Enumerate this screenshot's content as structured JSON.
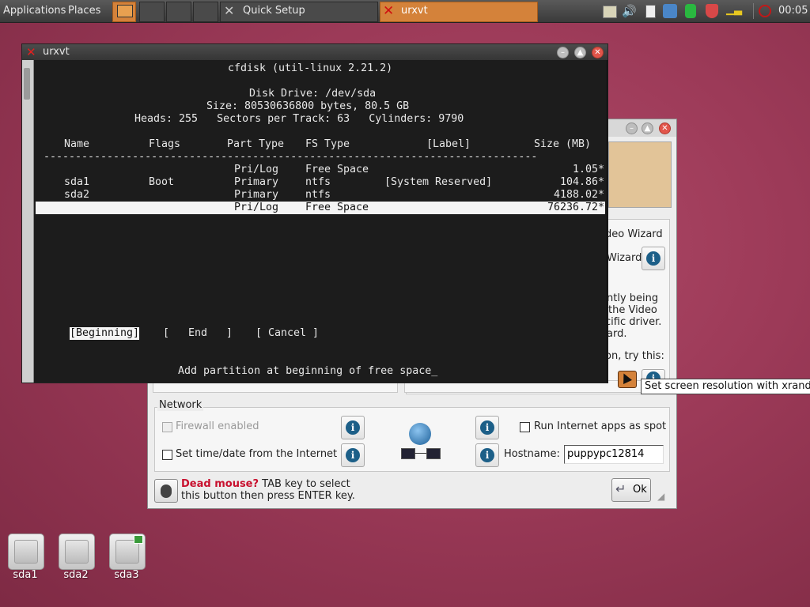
{
  "taskbar": {
    "applications_label": "Applications",
    "places_label": "Places",
    "task_quick_setup": "Quick Setup",
    "task_urxvt": "urxvt",
    "clock": "00:05"
  },
  "terminal": {
    "title": "urxvt",
    "program_title": "cfdisk (util-linux 2.21.2)",
    "disk_drive": "Disk Drive: /dev/sda",
    "size_line": "Size: 80530636800 bytes, 80.5 GB",
    "geometry_line": "Heads: 255   Sectors per Track: 63   Cylinders: 9790",
    "columns": [
      "Name",
      "Flags",
      "Part Type",
      "FS Type",
      "[Label]",
      "Size (MB)"
    ],
    "separator": "------------------------------------------------------------------------------",
    "rows": [
      {
        "name": "",
        "flags": "",
        "part_type": "Pri/Log",
        "fs_type": "Free Space",
        "label": "",
        "size": "1.05*"
      },
      {
        "name": "sda1",
        "flags": "Boot",
        "part_type": "Primary",
        "fs_type": "ntfs",
        "label": "[System Reserved]",
        "size": "104.86*"
      },
      {
        "name": "sda2",
        "flags": "",
        "part_type": "Primary",
        "fs_type": "ntfs",
        "label": "",
        "size": "4188.02*"
      },
      {
        "name": "",
        "flags": "",
        "part_type": "Pri/Log",
        "fs_type": "Free Space",
        "label": "",
        "size": "76236.72*"
      }
    ],
    "selected_row_index": 3,
    "menu": {
      "beginning": "[Beginning]",
      "end": "[   End   ]",
      "cancel": "[ Cancel ]"
    },
    "prompt": "Add partition at beginning of free space_"
  },
  "quick_setup": {
    "video_wizard_fragment": "deo Wizard",
    "wizard_fragment": "Wizard",
    "desc_lines": [
      "ntly being",
      "the Video",
      "cific driver.",
      "ard."
    ],
    "try_this": "on, try this:",
    "network_title": "Network",
    "firewall_label": "Firewall enabled",
    "set_time_label": "Set time/date from the Internet",
    "run_internet_label": "Run Internet apps as spot",
    "hostname_label": "Hostname:",
    "hostname_value": "puppypc12814",
    "dead_mouse_bold": "Dead mouse?",
    "dead_mouse_rest_1": " TAB key to select",
    "dead_mouse_tab": "TAB",
    "dead_mouse_line2": "this button then press ENTER key.",
    "ok_label": "Ok"
  },
  "tooltip": "Set screen resolution with xrandr",
  "desktop_icons": [
    "sda1",
    "sda2",
    "sda3"
  ],
  "colors": {
    "desktop": "#9c3a58",
    "accent_orange": "#d4823a",
    "info_blue": "#1c5f88",
    "dead_mouse_red": "#c8102e"
  }
}
